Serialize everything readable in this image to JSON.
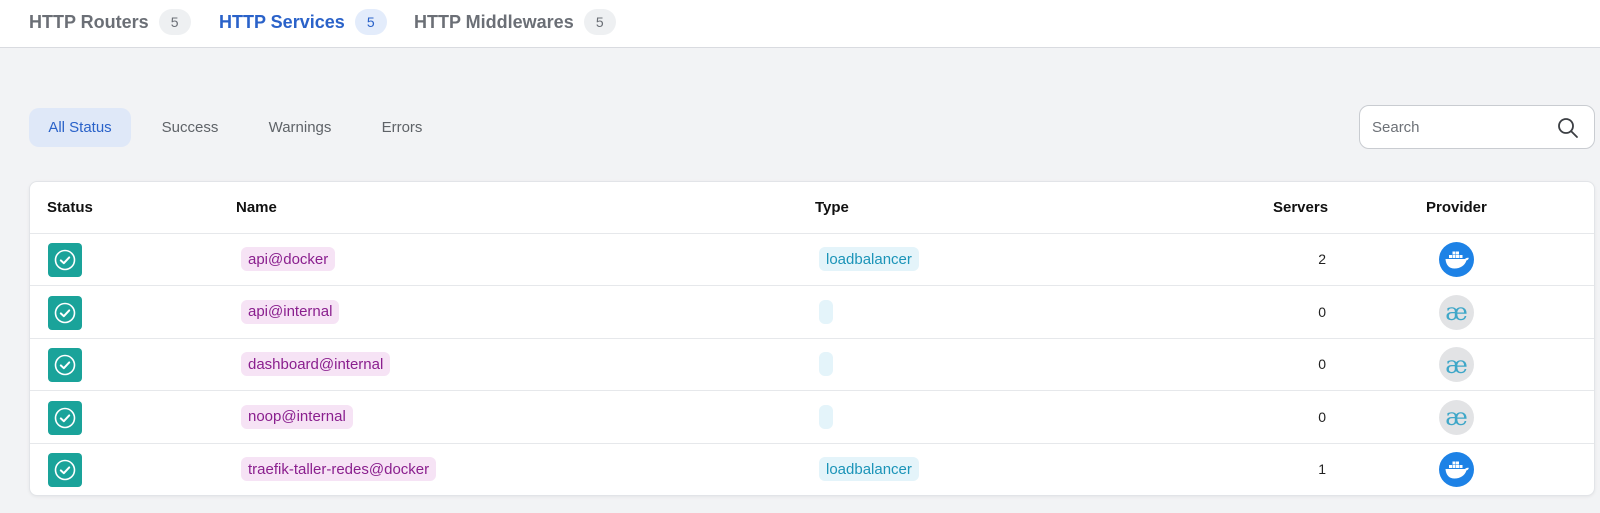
{
  "top_tabs": [
    {
      "label": "HTTP Routers",
      "count": "5",
      "active": false
    },
    {
      "label": "HTTP Services",
      "count": "5",
      "active": true
    },
    {
      "label": "HTTP Middlewares",
      "count": "5",
      "active": false
    }
  ],
  "filters": [
    {
      "label": "All Status",
      "active": true
    },
    {
      "label": "Success",
      "active": false
    },
    {
      "label": "Warnings",
      "active": false
    },
    {
      "label": "Errors",
      "active": false
    }
  ],
  "search": {
    "placeholder": "Search",
    "value": ""
  },
  "table": {
    "headers": {
      "status": "Status",
      "name": "Name",
      "type": "Type",
      "servers": "Servers",
      "provider": "Provider"
    },
    "rows": [
      {
        "status": "success",
        "name": "api@docker",
        "type": "loadbalancer",
        "servers": "2",
        "provider": "docker-icon"
      },
      {
        "status": "success",
        "name": "api@internal",
        "type": "",
        "servers": "0",
        "provider": "internal-icon"
      },
      {
        "status": "success",
        "name": "dashboard@internal",
        "type": "",
        "servers": "0",
        "provider": "internal-icon"
      },
      {
        "status": "success",
        "name": "noop@internal",
        "type": "",
        "servers": "0",
        "provider": "internal-icon"
      },
      {
        "status": "success",
        "name": "traefik-taller-redes@docker",
        "type": "loadbalancer",
        "servers": "1",
        "provider": "docker-icon"
      }
    ]
  },
  "internal_glyph": "æ",
  "colors": {
    "accent": "#2a62c9",
    "success": "#1aa39a",
    "name_chip_bg": "#f6e3f5",
    "name_chip_text": "#8a1f8e",
    "type_chip_bg": "#e4f4fa",
    "type_chip_text": "#1b94b8",
    "docker": "#1d82e6"
  }
}
